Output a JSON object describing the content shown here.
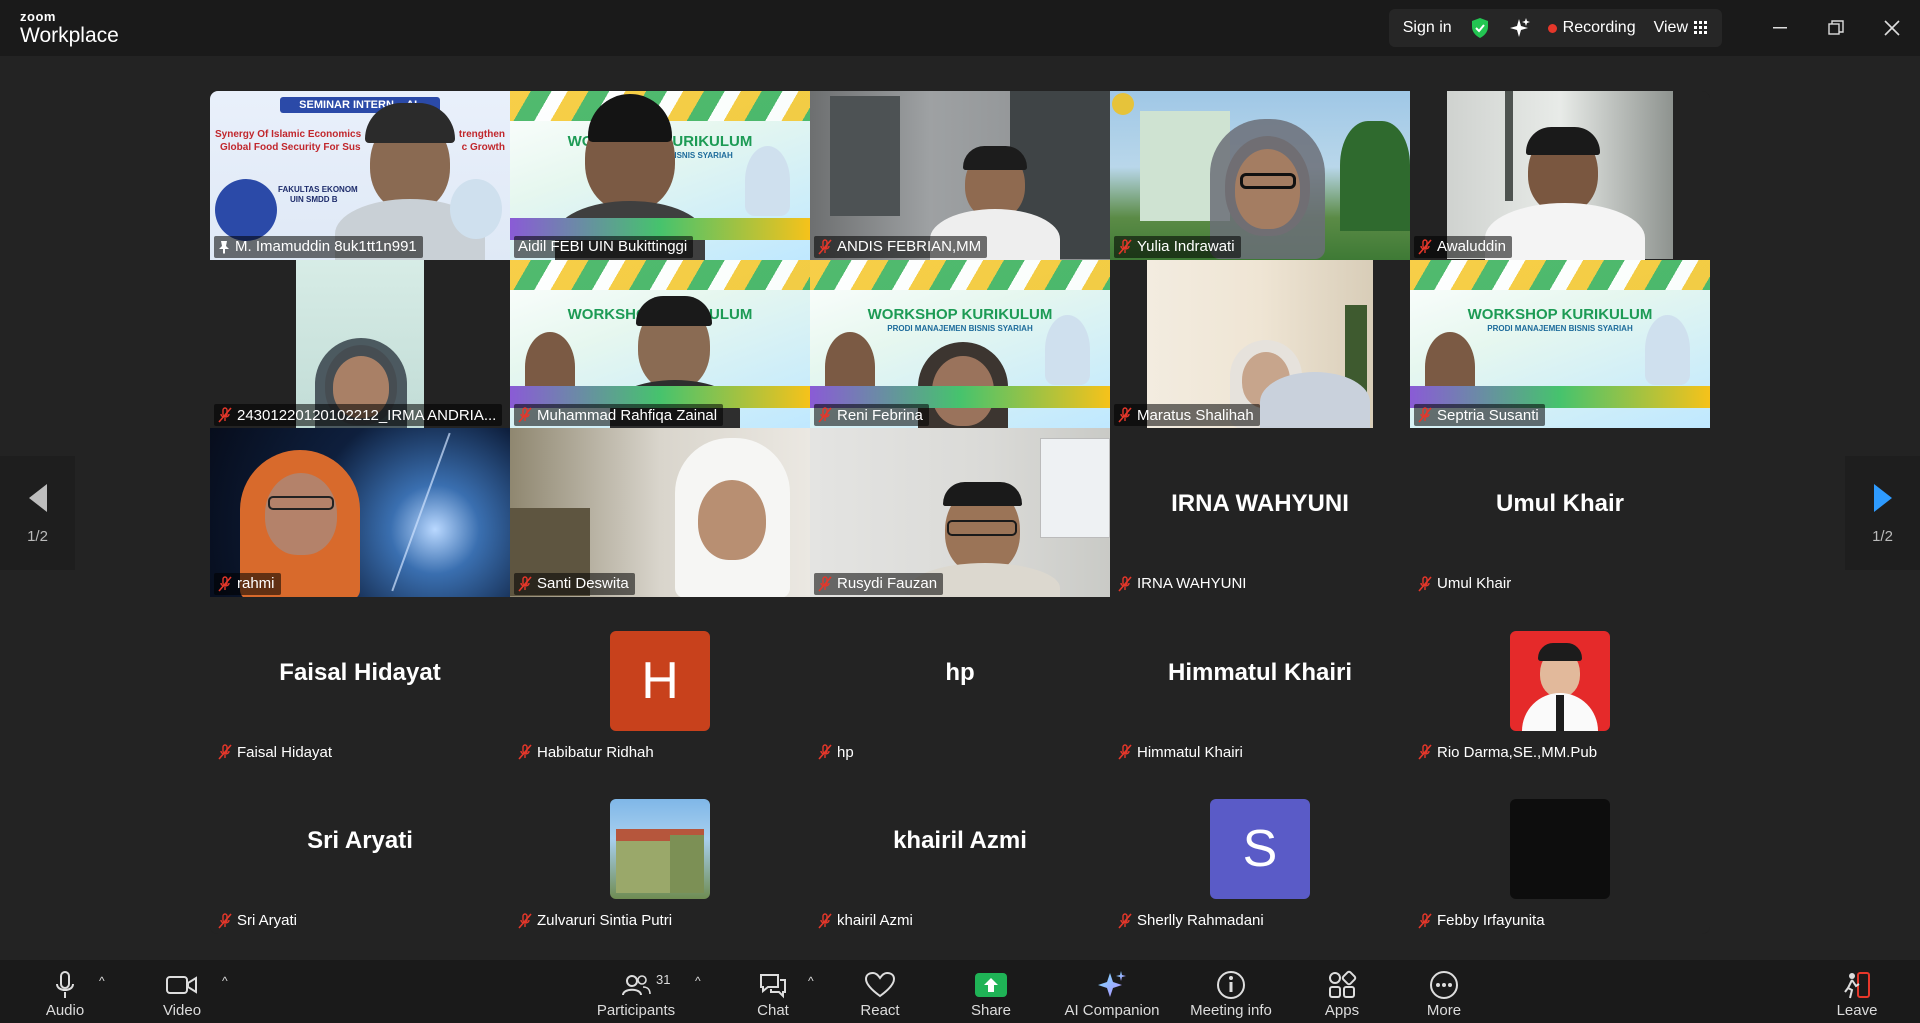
{
  "app": {
    "logo_top": "zoom",
    "logo_bottom": "Workplace"
  },
  "titlebar": {
    "sign_in": "Sign in",
    "recording": "Recording",
    "view": "View"
  },
  "pager": {
    "left": "1/2",
    "right": "1/2"
  },
  "participants": [
    {
      "name": "M. Imamuddin 8uk1tt1n991",
      "pinned": true
    },
    {
      "name": "Aidil FEBI UIN Bukittinggi",
      "active": true
    },
    {
      "name": "ANDIS FEBRIAN,MM"
    },
    {
      "name": "Yulia Indrawati"
    },
    {
      "name": "Awaluddin"
    },
    {
      "name": "24301220120102212_IRMA ANDRIA..."
    },
    {
      "name": "Muhammad Rahfiqa Zainal"
    },
    {
      "name": "Reni Febrina"
    },
    {
      "name": "Maratus Shalihah"
    },
    {
      "name": "Septria Susanti"
    },
    {
      "name": "rahmi"
    },
    {
      "name": "Santi Deswita"
    },
    {
      "name": "Rusydi Fauzan"
    },
    {
      "name": "IRNA WAHYUNI",
      "display": "IRNA WAHYUNI"
    },
    {
      "name": "Umul Khair",
      "display": "Umul Khair"
    },
    {
      "name": "Faisal Hidayat",
      "display": "Faisal Hidayat"
    },
    {
      "name": "Habibatur Ridhah",
      "initial": "H"
    },
    {
      "name": "hp",
      "display": "hp"
    },
    {
      "name": "Himmatul Khairi",
      "display": "Himmatul Khairi"
    },
    {
      "name": "Rio Darma,SE.,MM.Pub"
    },
    {
      "name": "Sri Aryati",
      "display": "Sri Aryati"
    },
    {
      "name": "Zulvaruri Sintia Putri"
    },
    {
      "name": "khairil Azmi",
      "display": "khairil Azmi"
    },
    {
      "name": "Sherlly Rahmadani",
      "initial": "S"
    },
    {
      "name": "Febby Irfayunita"
    }
  ],
  "slides": {
    "seminar_title": "SEMINAR INTERN",
    "seminar_title_end": "AL",
    "seminar_line1": "Synergy Of Islamic Economics",
    "seminar_line1_end": "trengthen",
    "seminar_line2": "Global Food Security For Sus",
    "seminar_line2_end": "c Growth",
    "seminar_dept": "FAKULTAS EKONOM",
    "seminar_uni": "UIN SMDD B",
    "workshop_title": "WORKSHOP KURIKULUM",
    "workshop_sub": "PRODI MANAJEMEN BISNIS SYARIAH"
  },
  "toolbar": {
    "audio": "Audio",
    "video": "Video",
    "participants": "Participants",
    "participants_count": "31",
    "chat": "Chat",
    "react": "React",
    "share": "Share",
    "ai": "AI Companion",
    "meeting_info": "Meeting info",
    "apps": "Apps",
    "more": "More",
    "leave": "Leave"
  },
  "colors": {
    "accent_green": "#23d18b",
    "recording_red": "#e5372a",
    "share_green": "#1fb356",
    "avatar_h": "#c8411c",
    "avatar_s": "#5a5bc7"
  }
}
